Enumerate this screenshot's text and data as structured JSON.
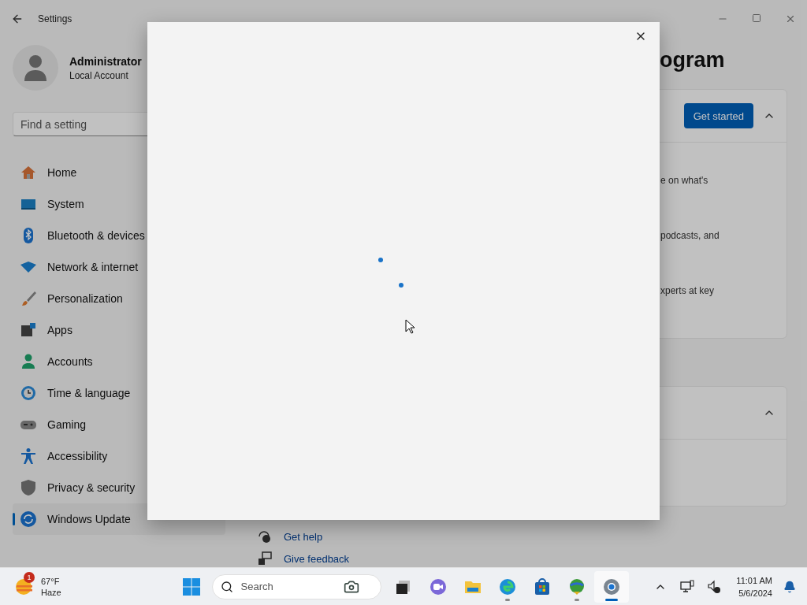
{
  "window": {
    "title": "Settings"
  },
  "account": {
    "name": "Administrator",
    "type": "Local Account"
  },
  "search": {
    "placeholder": "Find a setting"
  },
  "nav": [
    {
      "label": "Home",
      "kind": "home",
      "selected": false
    },
    {
      "label": "System",
      "kind": "system",
      "selected": false
    },
    {
      "label": "Bluetooth & devices",
      "kind": "bluetooth",
      "selected": false
    },
    {
      "label": "Network & internet",
      "kind": "network",
      "selected": false
    },
    {
      "label": "Personalization",
      "kind": "brush",
      "selected": false
    },
    {
      "label": "Apps",
      "kind": "apps",
      "selected": false
    },
    {
      "label": "Accounts",
      "kind": "accounts",
      "selected": false
    },
    {
      "label": "Time & language",
      "kind": "time",
      "selected": false
    },
    {
      "label": "Gaming",
      "kind": "gaming",
      "selected": false
    },
    {
      "label": "Accessibility",
      "kind": "accessibility",
      "selected": false
    },
    {
      "label": "Privacy & security",
      "kind": "privacy",
      "selected": false
    },
    {
      "label": "Windows Update",
      "kind": "update",
      "selected": true
    }
  ],
  "page": {
    "title": "ogram",
    "cards": [
      {
        "button": "Get started",
        "expanded": true,
        "lines": [
          "e on what's",
          "podcasts, and",
          "xperts at key"
        ]
      },
      {
        "expanded": true
      }
    ]
  },
  "links": [
    {
      "label": "Get help",
      "kind": "help"
    },
    {
      "label": "Give feedback",
      "kind": "feedback"
    }
  ],
  "taskbar": {
    "weather": {
      "badge": "1",
      "temp": "67°F",
      "condition": "Haze"
    },
    "search": {
      "placeholder": "Search"
    },
    "apps": [
      {
        "kind": "taskview",
        "active": false,
        "running": false
      },
      {
        "kind": "chat",
        "active": false,
        "running": false
      },
      {
        "kind": "explorer",
        "active": false,
        "running": false
      },
      {
        "kind": "edge",
        "active": false,
        "running": true
      },
      {
        "kind": "store",
        "active": false,
        "running": false
      },
      {
        "kind": "download",
        "active": false,
        "running": true
      },
      {
        "kind": "settings",
        "active": true,
        "running": true
      }
    ],
    "clock": {
      "time": "11:01 AM",
      "date": "5/6/2024"
    }
  }
}
